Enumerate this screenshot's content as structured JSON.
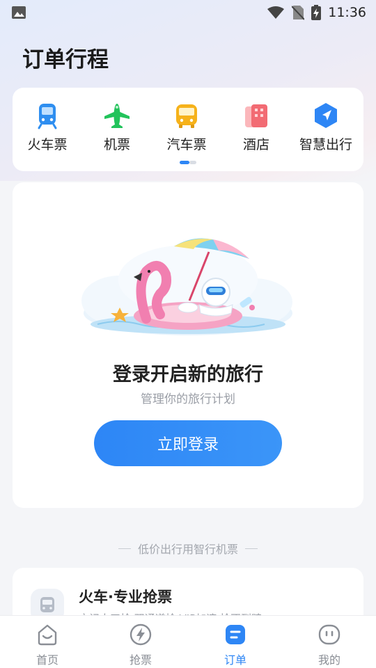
{
  "status_bar": {
    "time": "11:36"
  },
  "page": {
    "title": "订单行程"
  },
  "quick_entries": [
    {
      "label": "火车票",
      "icon": "train-icon",
      "color": "#2e8ef0"
    },
    {
      "label": "机票",
      "icon": "plane-icon",
      "color": "#22c35b"
    },
    {
      "label": "汽车票",
      "icon": "bus-icon",
      "color": "#f6b21a"
    },
    {
      "label": "酒店",
      "icon": "hotel-icon",
      "color": "#f26b73"
    },
    {
      "label": "智慧出行",
      "icon": "navigation-icon",
      "color": "#2e86f5"
    }
  ],
  "login_prompt": {
    "title": "登录开启新的旅行",
    "subtitle": "管理你的旅行计划",
    "button_label": "立即登录"
  },
  "promo_section": {
    "heading": "低价出行用智行机票"
  },
  "promo_card": {
    "title": "火车·专业抢票",
    "description": "方记人工抢 双通道抢 VIP加速 抢不到赔"
  },
  "tabs": [
    {
      "label": "首页",
      "icon": "home-icon",
      "active": false
    },
    {
      "label": "抢票",
      "icon": "grab-ticket-icon",
      "active": false
    },
    {
      "label": "订单",
      "icon": "orders-icon",
      "active": true
    },
    {
      "label": "我的",
      "icon": "profile-icon",
      "active": false
    }
  ],
  "colors": {
    "accent": "#2e86f5",
    "background": "#f4f5f8"
  }
}
